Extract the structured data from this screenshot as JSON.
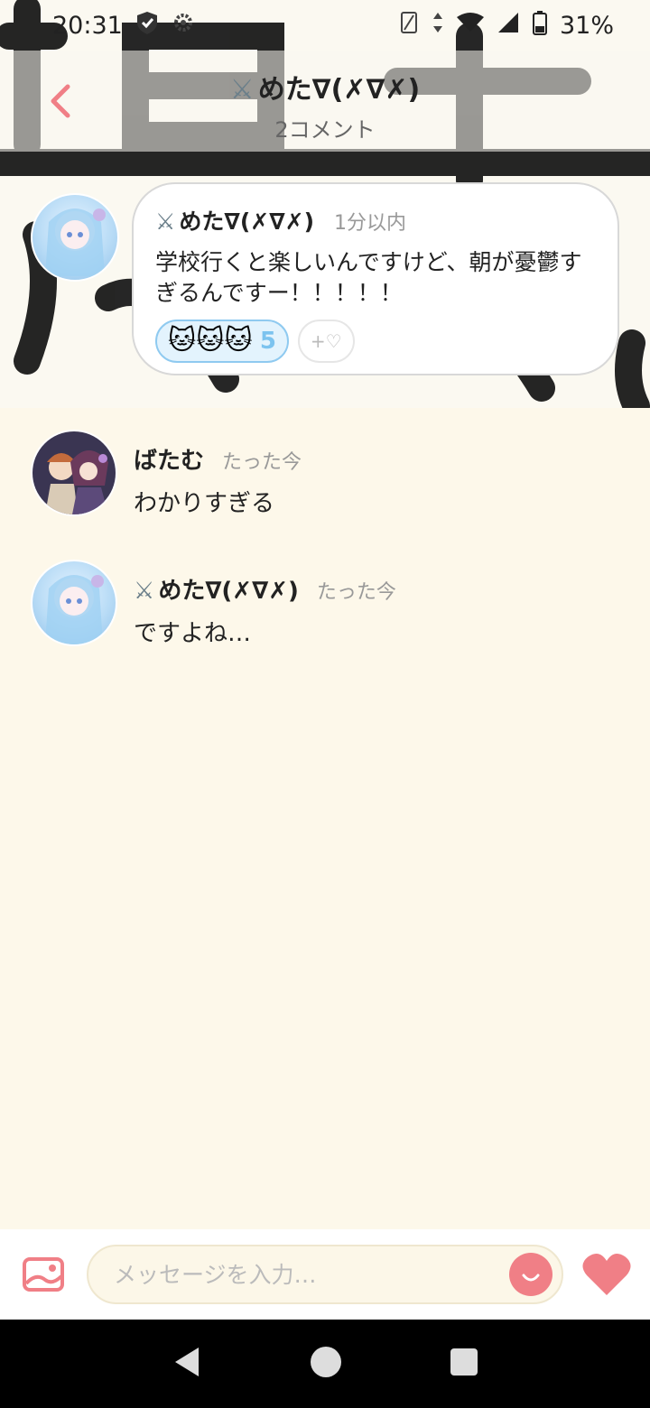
{
  "status_bar": {
    "time": "20:31",
    "battery": "31%"
  },
  "header": {
    "back_icon": "chevron-left-icon",
    "title_prefix": "⚔",
    "title": "めた∇(✗∇✗)",
    "subtitle": "2コメント"
  },
  "post": {
    "author_prefix": "⚔",
    "author": "めた∇(✗∇✗)",
    "time": "1分以内",
    "text": "学校行くと楽しいんですけど、朝が憂鬱すぎるんですー！！！！！",
    "reaction": {
      "emoji": "🐱🐱🐱",
      "count": "5"
    },
    "add_reaction_label": "+♡"
  },
  "comments": [
    {
      "author_prefix": "",
      "author": "ばたむ",
      "time": "たった今",
      "text": "わかりすぎる"
    },
    {
      "author_prefix": "⚔",
      "author": "めた∇(✗∇✗)",
      "time": "たった今",
      "text": "ですよね…"
    }
  ],
  "input_bar": {
    "placeholder": "メッセージを入力…"
  },
  "colors": {
    "accent_pink": "#f07f86",
    "reaction_blue": "#7cc3ef",
    "background": "#fdf8ea"
  }
}
